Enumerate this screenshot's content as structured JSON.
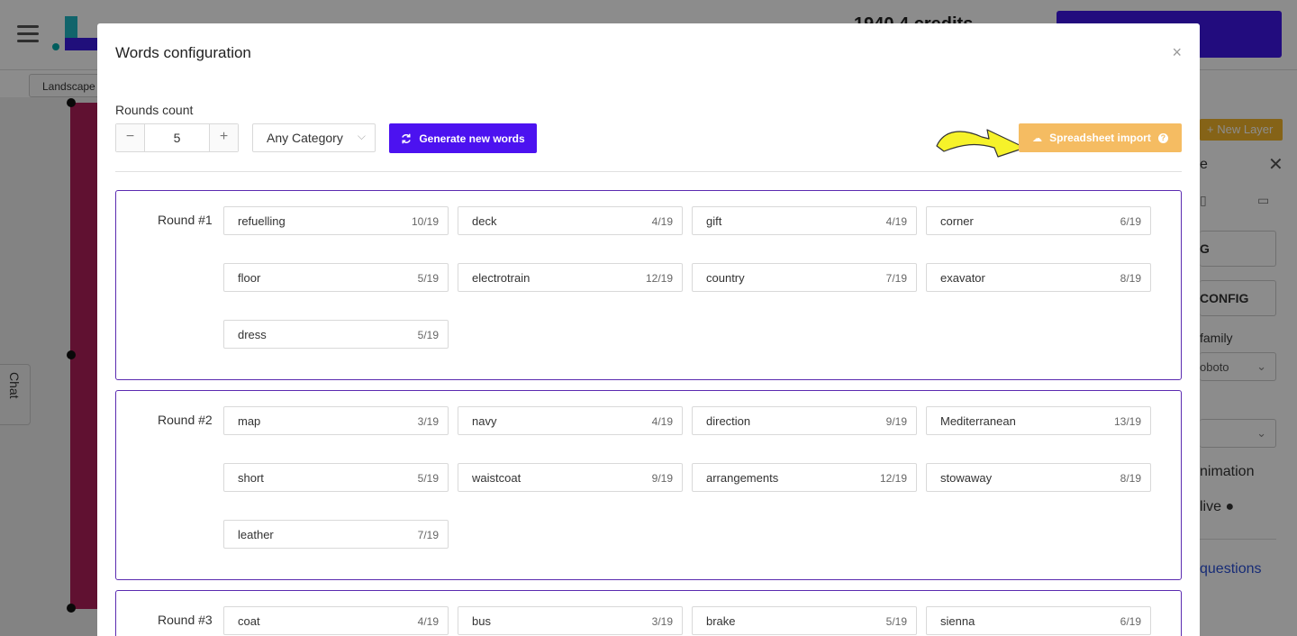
{
  "background": {
    "credits": "1940.4 credits",
    "landscape_label": "Landscape",
    "chat_label": "Chat",
    "new_layer_label": "New Layer",
    "panel_e": "e",
    "panel_btn1": "G",
    "panel_btn2": "CONFIG",
    "font_family_label": "family",
    "font_value": "oboto",
    "animation_label": "nimation",
    "live_label": "live",
    "questions_link": "questions"
  },
  "modal": {
    "title": "Words configuration",
    "close_icon": "×",
    "rounds_count_label": "Rounds count",
    "rounds_count_value": "5",
    "category": {
      "selected": "Any Category"
    },
    "generate_label": "Generate new words",
    "import_label": "Spreadsheet import",
    "arrow_color": "#f6f22a",
    "accent_color": "#4c12f0",
    "import_color": "#f5bc62",
    "rounds": [
      {
        "label": "Round #1",
        "words": [
          {
            "text": "refuelling",
            "count": "10/19"
          },
          {
            "text": "deck",
            "count": "4/19"
          },
          {
            "text": "gift",
            "count": "4/19"
          },
          {
            "text": "corner",
            "count": "6/19"
          },
          {
            "text": "floor",
            "count": "5/19"
          },
          {
            "text": "electrotrain",
            "count": "12/19"
          },
          {
            "text": "country",
            "count": "7/19"
          },
          {
            "text": "exavator",
            "count": "8/19"
          },
          {
            "text": "dress",
            "count": "5/19"
          }
        ]
      },
      {
        "label": "Round #2",
        "words": [
          {
            "text": "map",
            "count": "3/19"
          },
          {
            "text": "navy",
            "count": "4/19"
          },
          {
            "text": "direction",
            "count": "9/19"
          },
          {
            "text": "Mediterranean",
            "count": "13/19"
          },
          {
            "text": "short",
            "count": "5/19"
          },
          {
            "text": "waistcoat",
            "count": "9/19"
          },
          {
            "text": "arrangements",
            "count": "12/19"
          },
          {
            "text": "stowaway",
            "count": "8/19"
          },
          {
            "text": "leather",
            "count": "7/19"
          }
        ]
      },
      {
        "label": "Round #3",
        "words": [
          {
            "text": "coat",
            "count": "4/19"
          },
          {
            "text": "bus",
            "count": "3/19"
          },
          {
            "text": "brake",
            "count": "5/19"
          },
          {
            "text": "sienna",
            "count": "6/19"
          }
        ]
      }
    ]
  }
}
